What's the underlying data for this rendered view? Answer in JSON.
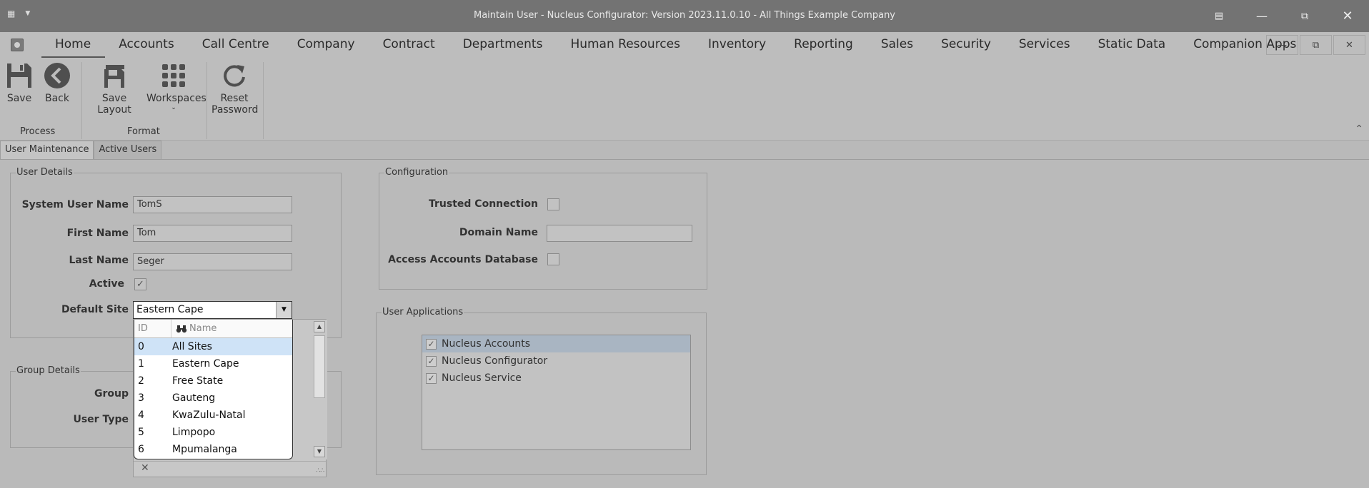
{
  "window": {
    "title": "Maintain User - Nucleus Configurator: Version 2023.11.0.10 - All Things Example Company"
  },
  "menu": {
    "items": [
      "Home",
      "Accounts",
      "Call Centre",
      "Company",
      "Contract",
      "Departments",
      "Human Resources",
      "Inventory",
      "Reporting",
      "Sales",
      "Security",
      "Services",
      "Static Data",
      "Companion Apps"
    ],
    "active": "Home"
  },
  "ribbon": {
    "save": "Save",
    "back": "Back",
    "save_layout": "Save Layout",
    "workspaces": "Workspaces",
    "reset_password_1": "Reset",
    "reset_password_2": "Password",
    "group_process": "Process",
    "group_format": "Format"
  },
  "tabs": [
    "User Maintenance",
    "Active Users"
  ],
  "user_details": {
    "title": "User Details",
    "system_user_name_label": "System User Name",
    "system_user_name": "TomS",
    "first_name_label": "First Name",
    "first_name": "Tom",
    "last_name_label": "Last Name",
    "last_name": "Seger",
    "active_label": "Active",
    "active": true,
    "default_site_label": "Default Site",
    "default_site": "Eastern Cape"
  },
  "group_details": {
    "title": "Group Details",
    "group_label": "Group",
    "user_type_label": "User Type"
  },
  "dropdown": {
    "col_id": "ID",
    "col_name": "Name",
    "rows": [
      {
        "id": "0",
        "name": "All Sites"
      },
      {
        "id": "1",
        "name": "Eastern Cape"
      },
      {
        "id": "2",
        "name": "Free State"
      },
      {
        "id": "3",
        "name": "Gauteng"
      },
      {
        "id": "4",
        "name": "KwaZulu-Natal"
      },
      {
        "id": "5",
        "name": "Limpopo"
      },
      {
        "id": "6",
        "name": "Mpumalanga"
      }
    ],
    "selected_index": 0
  },
  "configuration": {
    "title": "Configuration",
    "trusted_connection_label": "Trusted Connection",
    "domain_name_label": "Domain Name",
    "domain_name": "",
    "access_accounts_db_label": "Access Accounts Database"
  },
  "user_applications": {
    "title": "User Applications",
    "items": [
      {
        "name": "Nucleus Accounts",
        "checked": true,
        "selected": true
      },
      {
        "name": "Nucleus Configurator",
        "checked": true,
        "selected": false
      },
      {
        "name": "Nucleus Service",
        "checked": true,
        "selected": false
      }
    ]
  }
}
